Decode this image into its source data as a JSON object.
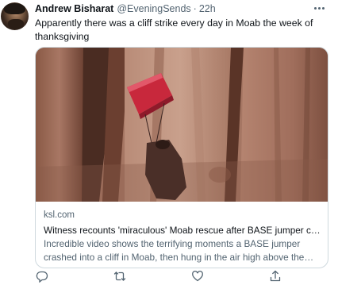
{
  "tweet": {
    "author_name": "Andrew Bisharat",
    "handle": "@EveningSends",
    "separator": "·",
    "time": "22h",
    "text": "Apparently there was a cliff strike every day in Moab the week of thanksgiving",
    "icons": {
      "more": "more-horizontal-icon",
      "reply": "reply-icon",
      "retweet": "retweet-icon",
      "like": "heart-icon",
      "share": "share-icon"
    }
  },
  "card": {
    "domain": "ksl.com",
    "title": "Witness recounts 'miraculous' Moab rescue after BASE jumper crashe...",
    "description": "Incredible video shows the terrifying moments a BASE jumper crashed into a cliff in Moab, then hung in the air high above the ground, his ..."
  },
  "colors": {
    "text_primary": "#0f1419",
    "text_secondary": "#536471",
    "border": "#cfd9de",
    "parachute": "#c8283c"
  }
}
